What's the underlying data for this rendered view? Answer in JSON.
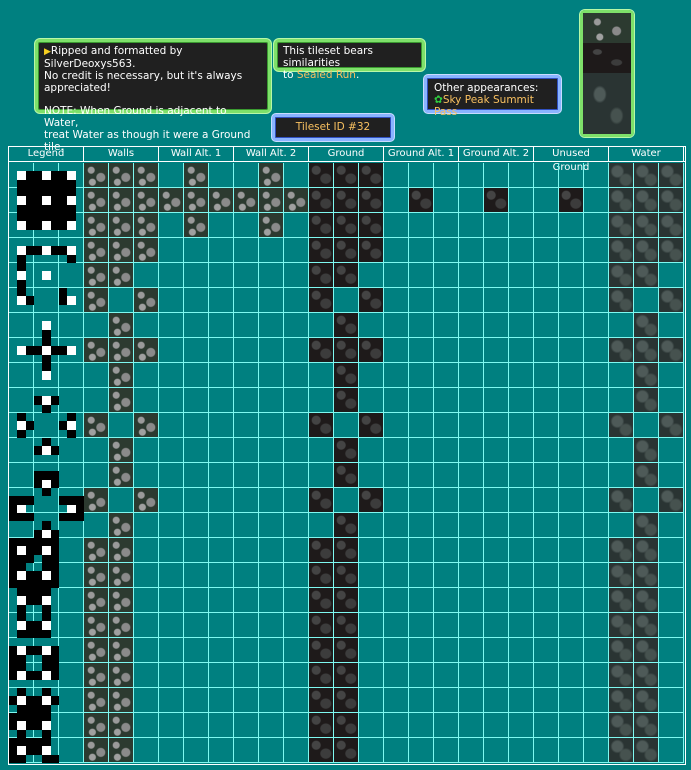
{
  "info_box": {
    "line1": "Ripped and formatted by SilverDeoxys563.",
    "line2": "No credit is necessary, but it's always",
    "line3": "appreciated!",
    "note1": "NOTE: When Ground is adjacent to Water,",
    "note2": "treat Water as though it were a Ground tile."
  },
  "similar_box": {
    "text": "This tileset bears similarities",
    "prefix": "to ",
    "link": "Sealed Run",
    "suffix": "."
  },
  "appearances_box": {
    "label": "Other appearances:",
    "icon": "green-gear-icon",
    "link": "Sky Peak Summit Pass"
  },
  "tileset_id": "Tileset ID #32",
  "colors": {
    "background": "#008080",
    "grid": "#7ff8f0",
    "highlight": "#f8c060"
  },
  "columns": [
    "Legend",
    "Walls",
    "Wall Alt. 1",
    "Wall Alt. 2",
    "Ground",
    "Ground Alt. 1",
    "Ground Alt. 2",
    "Unused Ground",
    "Water"
  ],
  "patterns": {
    "main": [
      "XXX",
      "XXX",
      "XXX",
      "XXX",
      "XX.",
      "X.X",
      ".X.",
      "XXX",
      ".X.",
      ".X.",
      "X.X",
      ".X.",
      ".X.",
      "X.X",
      ".X.",
      "XX.",
      "XX.",
      "XX.",
      "XX.",
      "XX.",
      "XX.",
      "XX.",
      "XX.",
      "XX."
    ],
    "alt_wall": [
      ".X.",
      "XXX",
      ".X."
    ],
    "alt_ground": [
      "...",
      ".X.",
      "..."
    ]
  },
  "legend_pixels": [
    ".........",
    ".WBBWBBW.",
    ".BBBBBBB.",
    ".BBBBBBB.",
    ".WBBWBBW.",
    ".BBBBBBB.",
    ".BBBBBBB.",
    ".WBBWBBW.",
    ".........",
    ".........",
    ".WBBWBBW.",
    ".B.....B.",
    ".B.......",
    ".W..W....",
    ".B.......",
    ".B....B..",
    ".WB...BW.",
    ".........",
    ".........",
    "....W....",
    "....B....",
    "....B....",
    ".WBBWBBW.",
    "....B....",
    "....B....",
    "....W....",
    ".........",
    ".........",
    "...BWB...",
    "....B....",
    ".B.....B.",
    ".WB...BW.",
    ".B.....B.",
    "....B....",
    "...BWB...",
    ".........",
    ".........",
    "...BBB...",
    "...BWB...",
    "....B....",
    "BBB...BBB",
    "BW.....WB",
    "BBB...BBB",
    "....B....",
    "...BWB...",
    "BBBBBB...",
    "BWBBWB...",
    "BBB.BB...",
    "BB..BB...",
    "BWBBWB...",
    "BBBBBB...",
    ".BBBB....",
    ".WBBW....",
    ".B..B....",
    ".B..B....",
    ".WBBW....",
    ".BBBB....",
    ".........",
    "BWBBWB...",
    "BB..BB...",
    "BB..BB...",
    "BWBBWB...",
    ".........",
    ".B..B....",
    "BWBBWB...",
    ".BBBB....",
    "BBBBB....",
    "BWBBW....",
    ".B..B....",
    "BBBBB....",
    "BWBBW....",
    "BB..BB..."
  ]
}
